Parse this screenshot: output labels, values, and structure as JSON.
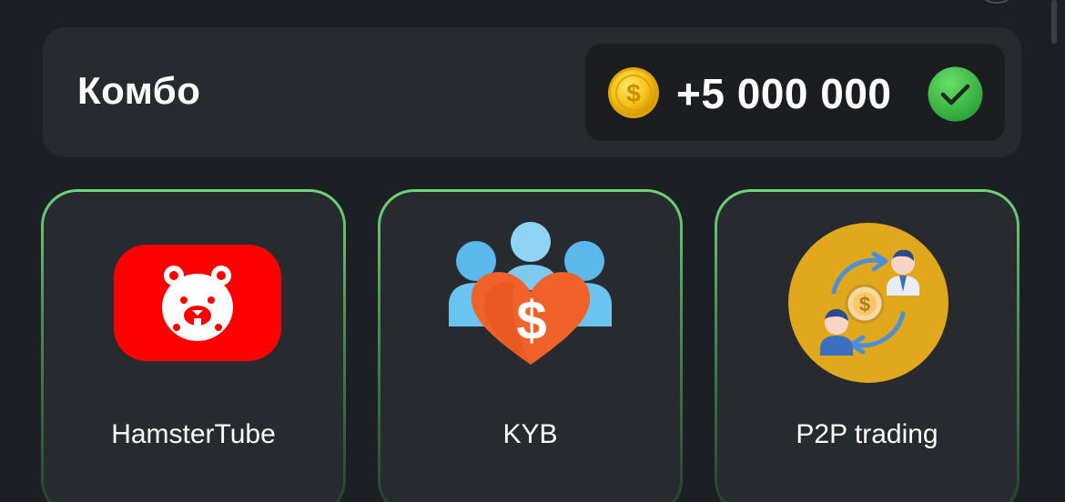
{
  "combo": {
    "title": "Комбо",
    "reward": "+5 000 000",
    "coin_icon": "dollar-coin-icon",
    "status_icon": "checkmark-icon",
    "status_color": "#3fbf3f",
    "coin_color": "#f5c518"
  },
  "cards": [
    {
      "label": "HamsterTube",
      "icon": "hamster-tube-icon",
      "color": "#fe0000"
    },
    {
      "label": "KYB",
      "icon": "kyb-people-heart-icon",
      "color": "#f0622a"
    },
    {
      "label": "P2P trading",
      "icon": "p2p-exchange-icon",
      "color": "#e1a81d"
    }
  ],
  "accent": "#6fd37a"
}
